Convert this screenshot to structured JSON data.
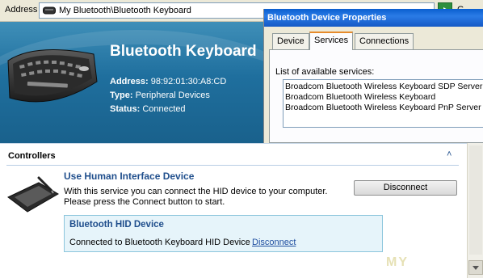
{
  "address_bar": {
    "label": "Address",
    "path": "My Bluetooth\\Bluetooth Keyboard",
    "go_label": "G"
  },
  "device": {
    "name": "Bluetooth Keyboard",
    "address_label": "Address:",
    "address_value": "98:92:01:30:A8:CD",
    "type_label": "Type:",
    "type_value": "Peripheral Devices",
    "status_label": "Status:",
    "status_value": "Connected",
    "image": "keyboard-image"
  },
  "dialog": {
    "title": "Bluetooth Device Properties",
    "tabs": [
      {
        "label": "Device",
        "active": false
      },
      {
        "label": "Services",
        "active": true
      },
      {
        "label": "Connections",
        "active": false
      }
    ],
    "list_label": "List of available services:",
    "services": [
      "Broadcom Bluetooth Wireless Keyboard SDP Server",
      "Broadcom Bluetooth Wireless  Keyboard",
      "Broadcom Bluetooth Wireless Keyboard PnP Server"
    ]
  },
  "controllers": {
    "title": "Controllers",
    "collapse_glyph": "˄",
    "service_title": "Use Human Interface Device",
    "service_desc": "With this service you can connect the HID device to your computer. Please press the Connect button to start.",
    "action_button": "Disconnect",
    "hid_box": {
      "title": "Bluetooth HID Device",
      "status": "Connected to Bluetooth Keyboard HID Device",
      "link": "Disconnect"
    }
  },
  "watermark": "MY",
  "colors": {
    "header_blue": "#1f6f9e",
    "title_blue": "#1f4e8c",
    "dialog_title": "#0a5fcf",
    "hid_box_bg": "#e6f4fa"
  }
}
